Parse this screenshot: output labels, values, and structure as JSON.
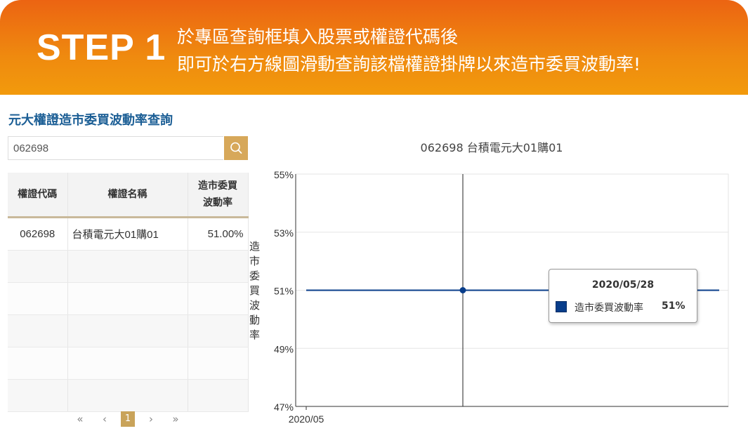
{
  "banner": {
    "step": "STEP 1",
    "line1": "於專區查詢框填入股票或權證代碼後",
    "line2": "即可於右方線圖滑動查詢該檔權證掛牌以來造市委買波動率!"
  },
  "panel": {
    "title": "元大權證造市委買波動率查詢",
    "search_value": "062698",
    "search_icon": "search-icon"
  },
  "table": {
    "headers": [
      "權證代碼",
      "權證名稱",
      "造市委買\n波動率"
    ],
    "rows": [
      {
        "code": "062698",
        "name": "台積電元大01購01",
        "vol": "51.00%"
      }
    ]
  },
  "pagination": {
    "first": "«",
    "prev": "‹",
    "current": "1",
    "next": "›",
    "last": "»"
  },
  "chart_data": {
    "type": "line",
    "title": "062698 台積電元大01購01",
    "ylabel": "造市委買波動率",
    "xlabel": "",
    "yticks": [
      "55%",
      "53%",
      "51%",
      "49%",
      "47%"
    ],
    "ylim": [
      47,
      55
    ],
    "xtick": "2020/05",
    "series": [
      {
        "name": "造市委買波動率",
        "color": "#083d8a",
        "points": [
          {
            "x": "2020/05/28",
            "y": 51
          }
        ]
      }
    ],
    "tooltip": {
      "date": "2020/05/28",
      "label": "造市委買波動率",
      "value": "51%"
    }
  }
}
